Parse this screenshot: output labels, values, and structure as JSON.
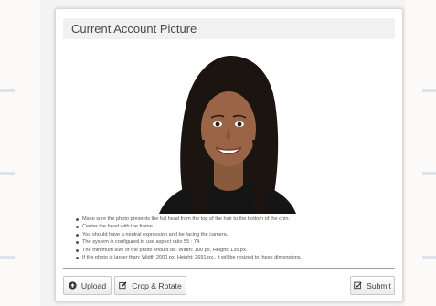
{
  "dialog": {
    "title": "Current Account Picture"
  },
  "photo": {
    "alt": "Account picture"
  },
  "instructions": [
    "Make sure the photo presents the full head from the top of the hair to the bottom of the chin.",
    "Center the head with the frame.",
    "You should have a neutral expression and be facing the camera.",
    "The system is configured to use aspect ratio 55 : 74.",
    "The minimum size of the photo should be: Width: 100 px, Height: 135 px.",
    "If the photo is larger than: Width 2000 px, Height: 2691 px., it will be resized to these dimensions."
  ],
  "buttons": {
    "upload_label": "Upload",
    "crop_label": "Crop & Rotate",
    "submit_label": "Submit"
  },
  "colors": {
    "header_bg": "#f1f1f1",
    "divider": "#9aa3aa",
    "button_text": "#444444"
  }
}
